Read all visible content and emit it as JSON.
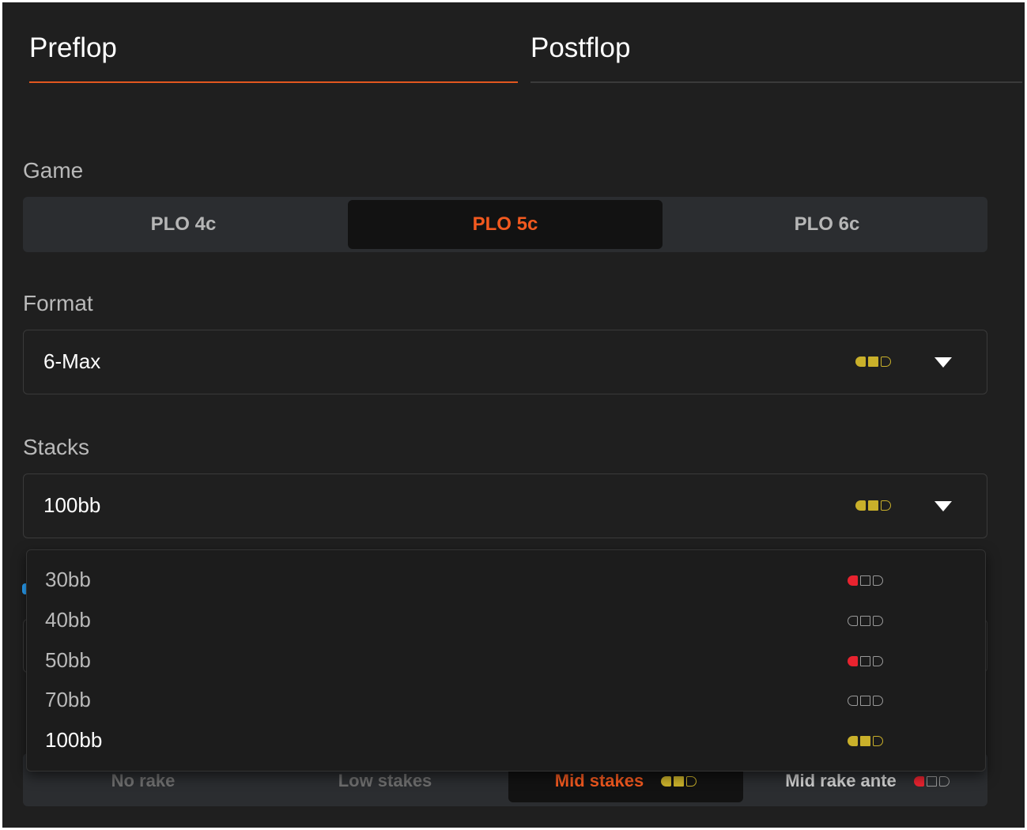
{
  "tabs": [
    {
      "label": "Preflop",
      "active": true
    },
    {
      "label": "Postflop",
      "active": false
    }
  ],
  "game": {
    "label": "Game",
    "options": [
      "PLO 4c",
      "PLO 5c",
      "PLO 6c"
    ],
    "selected": "PLO 5c"
  },
  "format": {
    "label": "Format",
    "value": "6-Max",
    "indicator": [
      "gold",
      "gold",
      "empty"
    ]
  },
  "stacks": {
    "label": "Stacks",
    "value": "100bb",
    "indicator": [
      "gold",
      "gold",
      "empty"
    ],
    "options": [
      {
        "label": "30bb",
        "indicator": [
          "red",
          "empty",
          "empty"
        ]
      },
      {
        "label": "40bb",
        "indicator": [
          "empty",
          "empty",
          "empty"
        ]
      },
      {
        "label": "50bb",
        "indicator": [
          "red",
          "empty",
          "empty"
        ]
      },
      {
        "label": "70bb",
        "indicator": [
          "empty",
          "empty",
          "empty"
        ]
      },
      {
        "label": "100bb",
        "indicator": [
          "gold",
          "gold",
          "empty"
        ],
        "selected": true
      }
    ]
  },
  "rake": {
    "options": [
      {
        "label": "No rake"
      },
      {
        "label": "Low stakes"
      },
      {
        "label": "Mid stakes",
        "selected": true,
        "indicator": [
          "gold",
          "gold",
          "empty"
        ]
      },
      {
        "label": "Mid rake ante",
        "indicator": [
          "red",
          "empty",
          "empty"
        ]
      }
    ]
  },
  "colors": {
    "accent": "#f2591f",
    "background": "#1f1f1f",
    "segment_bg": "#2b2d30",
    "indicator_gold": "#c9b02a",
    "indicator_red": "#e8232f"
  }
}
